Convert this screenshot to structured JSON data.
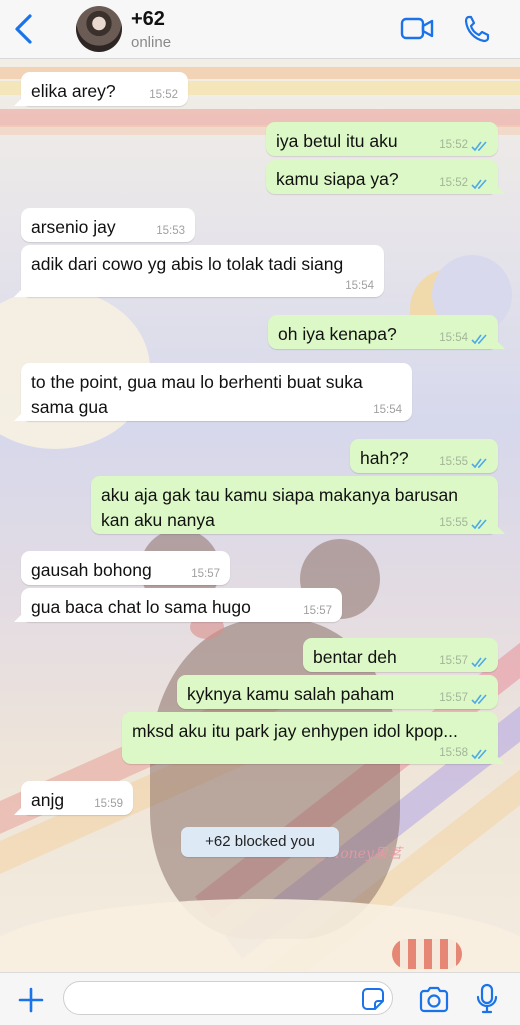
{
  "header": {
    "contact_name": "+62",
    "contact_status": "online",
    "back_icon": "chevron-left-icon",
    "video_icon": "video-camera-icon",
    "call_icon": "phone-icon",
    "accent_color": "#1a73e8"
  },
  "messages": [
    {
      "dir": "in",
      "text": "elika arey?",
      "time": "15:52"
    },
    {
      "dir": "out",
      "text": "iya betul itu aku",
      "time": "15:52",
      "read": true
    },
    {
      "dir": "out",
      "text": "kamu siapa ya?",
      "time": "15:52",
      "read": true
    },
    {
      "dir": "in",
      "text": "arsenio jay",
      "time": "15:53"
    },
    {
      "dir": "in",
      "text": "adik dari cowo yg abis lo tolak tadi siang",
      "time": "15:54"
    },
    {
      "dir": "out",
      "text": "oh iya kenapa?",
      "time": "15:54",
      "read": true
    },
    {
      "dir": "in",
      "text": "to the point, gua mau lo berhenti buat suka\nsama gua",
      "time": "15:54"
    },
    {
      "dir": "out",
      "text": "hah??",
      "time": "15:55",
      "read": true
    },
    {
      "dir": "out",
      "text": "aku aja gak tau kamu siapa makanya barusan\nkan aku nanya",
      "time": "15:55",
      "read": true
    },
    {
      "dir": "in",
      "text": "gausah bohong",
      "time": "15:57"
    },
    {
      "dir": "in",
      "text": "gua baca chat lo sama hugo",
      "time": "15:57"
    },
    {
      "dir": "out",
      "text": "bentar deh",
      "time": "15:57",
      "read": true
    },
    {
      "dir": "out",
      "text": "kyknya kamu salah paham",
      "time": "15:57",
      "read": true
    },
    {
      "dir": "out",
      "text": "mksd aku itu park jay enhypen idol kpop...",
      "time": "15:58",
      "read": true
    },
    {
      "dir": "in",
      "text": "anjg",
      "time": "15:59"
    }
  ],
  "system_note": "+62 blocked you",
  "watermark": "@Honey果茗",
  "input_bar": {
    "placeholder": "",
    "plus_icon": "plus-icon",
    "sticker_icon": "sticker-icon",
    "camera_icon": "camera-icon",
    "mic_icon": "microphone-icon"
  },
  "colors": {
    "incoming_bubble": "#ffffff",
    "outgoing_bubble": "#dcf8c6",
    "read_ticks": "#4fa9e6",
    "system_note": "#dde9f5"
  }
}
